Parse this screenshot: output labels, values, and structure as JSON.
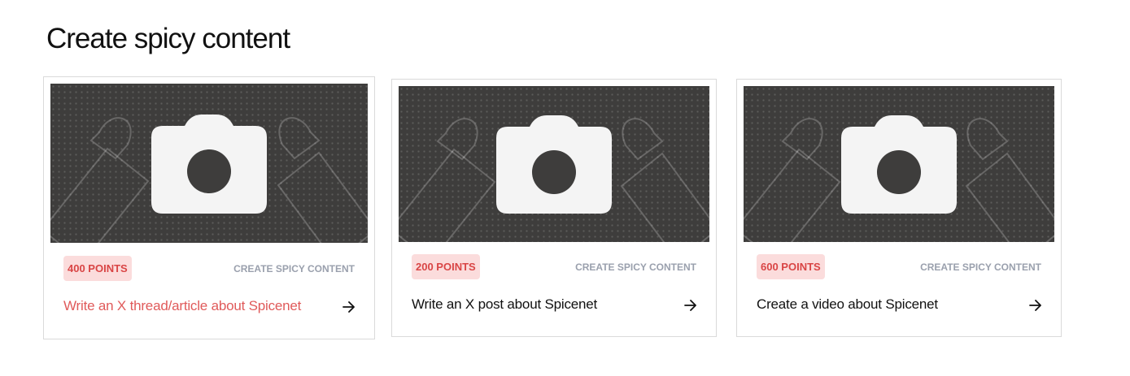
{
  "section": {
    "title": "Create spicy content"
  },
  "cards": [
    {
      "points": "400 POINTS",
      "category": "CREATE SPICY CONTENT",
      "title": "Write an X thread/article about Spicenet",
      "image_icon": "camera-icon",
      "action_icon": "arrow-right-icon",
      "state": "hover"
    },
    {
      "points": "200 POINTS",
      "category": "CREATE SPICY CONTENT",
      "title": "Write an X post about Spicenet",
      "image_icon": "camera-icon",
      "action_icon": "arrow-right-icon"
    },
    {
      "points": "600 POINTS",
      "category": "CREATE SPICY CONTENT",
      "title": "Create a video about Spicenet",
      "image_icon": "camera-icon",
      "action_icon": "arrow-right-icon"
    }
  ],
  "colors": {
    "badge_background": "#fbdcdc",
    "badge_text": "#d94545",
    "hover_title": "#e05a5a",
    "category_text": "#9aa0ad",
    "thumbnail_background": "#3e3d3c"
  }
}
